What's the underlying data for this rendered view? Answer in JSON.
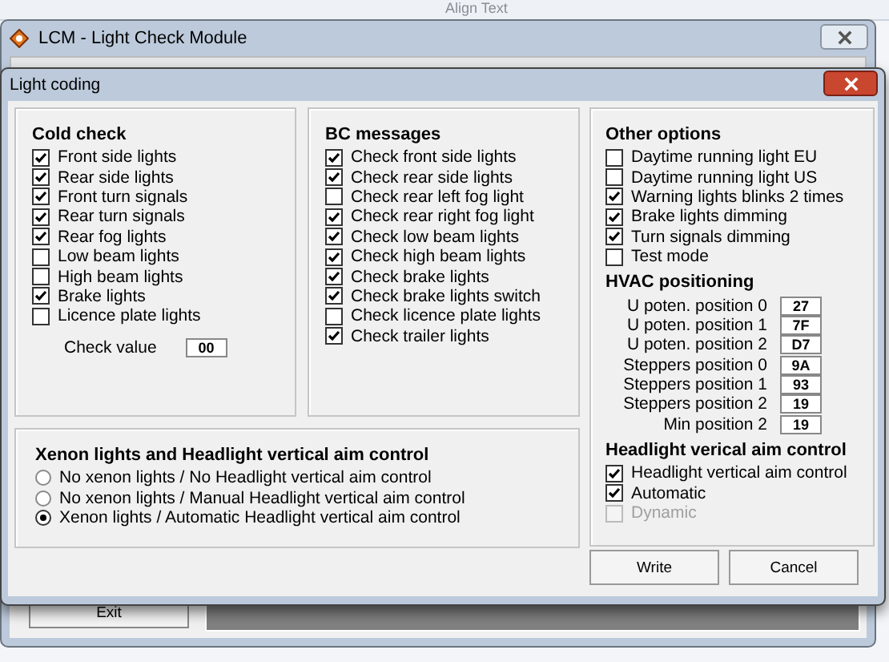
{
  "toolbar": {
    "label": "Align Text"
  },
  "window": {
    "title": "LCM - Light Check Module"
  },
  "dialog": {
    "title": "Light coding",
    "cold_check": {
      "title": "Cold check",
      "items": [
        {
          "label": "Front side lights",
          "checked": true
        },
        {
          "label": "Rear side lights",
          "checked": true
        },
        {
          "label": "Front turn signals",
          "checked": true
        },
        {
          "label": "Rear turn signals",
          "checked": true
        },
        {
          "label": "Rear fog lights",
          "checked": true
        },
        {
          "label": "Low beam lights",
          "checked": false
        },
        {
          "label": "High beam lights",
          "checked": false
        },
        {
          "label": "Brake lights",
          "checked": true
        },
        {
          "label": "Licence plate lights",
          "checked": false
        }
      ],
      "check_value": {
        "label": "Check value",
        "value": "00"
      }
    },
    "bc_messages": {
      "title": "BC messages",
      "items": [
        {
          "label": "Check front side lights",
          "checked": true
        },
        {
          "label": "Check rear side lights",
          "checked": true
        },
        {
          "label": "Check rear left fog light",
          "checked": false
        },
        {
          "label": "Check rear right fog light",
          "checked": true
        },
        {
          "label": "Check low beam lights",
          "checked": true
        },
        {
          "label": "Check high beam lights",
          "checked": true
        },
        {
          "label": "Check brake lights",
          "checked": true
        },
        {
          "label": "Check brake lights switch",
          "checked": true
        },
        {
          "label": "Check licence plate lights",
          "checked": false
        },
        {
          "label": "Check trailer lights",
          "checked": true
        }
      ]
    },
    "other_options": {
      "title": "Other options",
      "items": [
        {
          "label": "Daytime running light EU",
          "checked": false
        },
        {
          "label": "Daytime running light US",
          "checked": false
        },
        {
          "label": "Warning lights blinks 2 times",
          "checked": true
        },
        {
          "label": "Brake lights dimming",
          "checked": true
        },
        {
          "label": "Turn signals dimming",
          "checked": true
        },
        {
          "label": "Test mode",
          "checked": false
        }
      ]
    },
    "hvac": {
      "title": "HVAC positioning",
      "fields": [
        {
          "label": "U poten. position 0",
          "value": "27"
        },
        {
          "label": "U poten. position 1",
          "value": "7F"
        },
        {
          "label": "U poten. position 2",
          "value": "D7"
        },
        {
          "label": "Steppers position 0",
          "value": "9A"
        },
        {
          "label": "Steppers position 1",
          "value": "93"
        },
        {
          "label": "Steppers position 2",
          "value": "19"
        },
        {
          "label": "Min position 2",
          "value": "19"
        }
      ]
    },
    "headlight": {
      "title": "Headlight verical aim control",
      "items": [
        {
          "label": "Headlight vertical aim control",
          "checked": true,
          "disabled": false
        },
        {
          "label": "Automatic",
          "checked": true,
          "disabled": false
        },
        {
          "label": "Dynamic",
          "checked": false,
          "disabled": true
        }
      ]
    },
    "xenon": {
      "title": "Xenon lights and Headlight vertical aim control",
      "options": [
        {
          "label": "No xenon lights / No Headlight vertical aim control",
          "selected": false
        },
        {
          "label": "No xenon lights / Manual Headlight vertical aim control",
          "selected": false
        },
        {
          "label": "Xenon lights / Automatic Headlight vertical aim control",
          "selected": true
        }
      ]
    },
    "buttons": [
      "Write",
      "Cancel"
    ]
  },
  "exit_button": "Exit"
}
